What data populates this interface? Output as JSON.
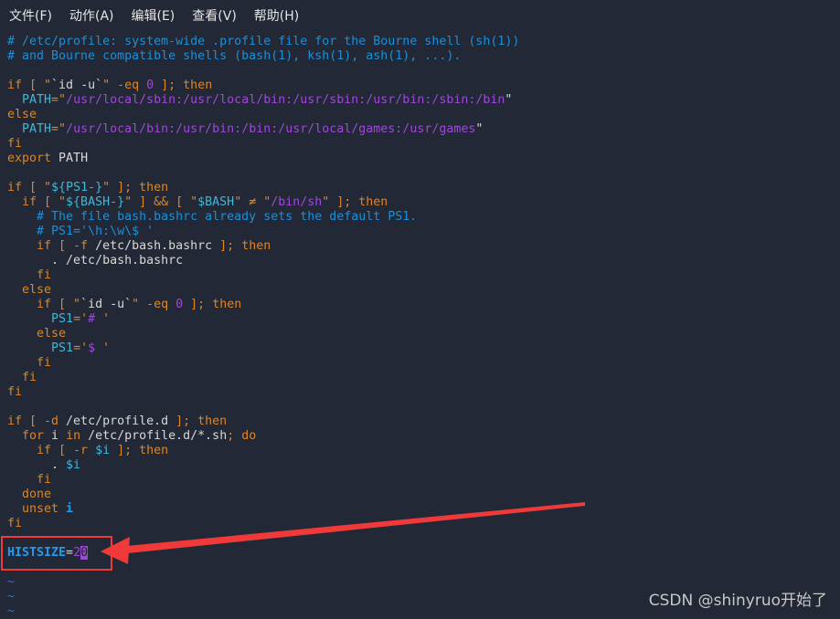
{
  "menu": [
    {
      "label": "文件(F)"
    },
    {
      "label": "动作(A)"
    },
    {
      "label": "编辑(E)"
    },
    {
      "label": "查看(V)"
    },
    {
      "label": "帮助(H)"
    }
  ],
  "colors": {
    "keyword": "#d9862c",
    "comment": "#1e8fd6",
    "string": "#9b4ad6",
    "variable": "#42b6d6",
    "highlight": "#f03a3a",
    "background": "#232836"
  },
  "lines": [
    [
      [
        "c",
        "# /etc/profile: system-wide .profile file for the Bourne shell (sh(1))"
      ]
    ],
    [
      [
        "c",
        "# and Bourne compatible shells (bash(1), ksh(1), ash(1), ...)."
      ]
    ],
    [],
    [
      [
        "k",
        "if [ \""
      ],
      [
        "p",
        "`id -u`"
      ],
      [
        "k",
        "\" -eq "
      ],
      [
        "n",
        "0"
      ],
      [
        "k",
        " ]; then"
      ]
    ],
    [
      [
        "v",
        "  PATH"
      ],
      [
        "k",
        "=\""
      ],
      [
        "s",
        "/usr/local/sbin:/usr/local/bin:/usr/sbin:/usr/bin:/sbin:/bin"
      ],
      [
        "p",
        "\""
      ]
    ],
    [
      [
        "k",
        "else"
      ]
    ],
    [
      [
        "v",
        "  PATH"
      ],
      [
        "k",
        "=\""
      ],
      [
        "s",
        "/usr/local/bin:/usr/bin:/bin:/usr/local/games:/usr/games"
      ],
      [
        "p",
        "\""
      ]
    ],
    [
      [
        "k",
        "fi"
      ]
    ],
    [
      [
        "k",
        "export "
      ],
      [
        "p",
        "PATH"
      ]
    ],
    [],
    [
      [
        "k",
        "if [ \""
      ],
      [
        "v",
        "${PS1-}"
      ],
      [
        "k",
        "\" ]; then"
      ]
    ],
    [
      [
        "k",
        "  if [ \""
      ],
      [
        "v",
        "${BASH-}"
      ],
      [
        "k",
        "\" ] && [ \""
      ],
      [
        "v",
        "$BASH"
      ],
      [
        "k",
        "\" ≠ \""
      ],
      [
        "s",
        "/bin/sh"
      ],
      [
        "k",
        "\" ]; then"
      ]
    ],
    [
      [
        "c",
        "    # The file bash.bashrc already sets the default PS1."
      ]
    ],
    [
      [
        "c",
        "    # PS1='\\h:\\w\\$ '"
      ]
    ],
    [
      [
        "k",
        "    if [ -f "
      ],
      [
        "p",
        "/etc/bash.bashrc"
      ],
      [
        "k",
        " ]; then"
      ]
    ],
    [
      [
        "p",
        "      . /etc/bash.bashrc"
      ]
    ],
    [
      [
        "k",
        "    fi"
      ]
    ],
    [
      [
        "k",
        "  else"
      ]
    ],
    [
      [
        "k",
        "    if [ \""
      ],
      [
        "p",
        "`id -u`"
      ],
      [
        "k",
        "\" -eq "
      ],
      [
        "n",
        "0"
      ],
      [
        "k",
        " ]; then"
      ]
    ],
    [
      [
        "v",
        "      PS1"
      ],
      [
        "k",
        "='"
      ],
      [
        "s",
        "#"
      ],
      [
        "k",
        " '"
      ]
    ],
    [
      [
        "k",
        "    else"
      ]
    ],
    [
      [
        "v",
        "      PS1"
      ],
      [
        "k",
        "='"
      ],
      [
        "s",
        "$"
      ],
      [
        "k",
        " '"
      ]
    ],
    [
      [
        "k",
        "    fi"
      ]
    ],
    [
      [
        "k",
        "  fi"
      ]
    ],
    [
      [
        "k",
        "fi"
      ]
    ],
    [],
    [
      [
        "k",
        "if [ -d "
      ],
      [
        "p",
        "/etc/profile.d"
      ],
      [
        "k",
        " ]; then"
      ]
    ],
    [
      [
        "k",
        "  for "
      ],
      [
        "p",
        "i "
      ],
      [
        "k",
        "in "
      ],
      [
        "p",
        "/etc/profile.d/*.sh"
      ],
      [
        "k",
        "; do"
      ]
    ],
    [
      [
        "k",
        "    if [ -r "
      ],
      [
        "v",
        "$i"
      ],
      [
        "k",
        " ]; then"
      ]
    ],
    [
      [
        "p",
        "      . "
      ],
      [
        "v",
        "$i"
      ]
    ],
    [
      [
        "k",
        "    fi"
      ]
    ],
    [
      [
        "k",
        "  done"
      ]
    ],
    [
      [
        "k",
        "  unset "
      ],
      [
        "b",
        "i"
      ]
    ],
    [
      [
        "k",
        "fi"
      ]
    ],
    [],
    [
      [
        "b",
        "HISTSIZE"
      ],
      [
        "p",
        "="
      ],
      [
        "n",
        "2"
      ],
      [
        "h",
        "0"
      ]
    ],
    [],
    [
      [
        "t",
        "~"
      ]
    ],
    [
      [
        "t",
        "~"
      ]
    ],
    [
      [
        "t",
        "~"
      ]
    ]
  ],
  "watermark": "CSDN @shinyruo开始了"
}
